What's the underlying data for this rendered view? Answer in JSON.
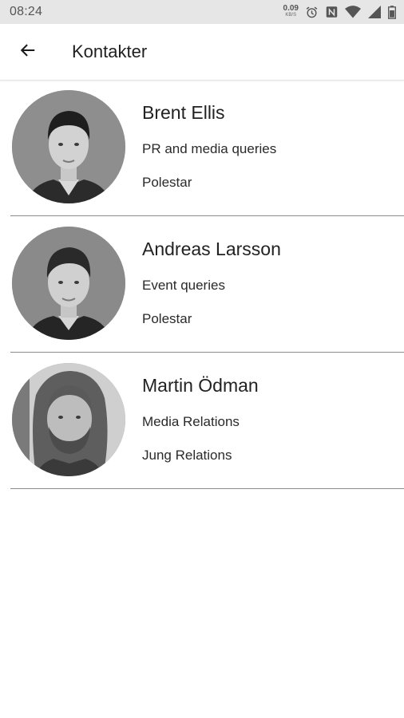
{
  "status_bar": {
    "time": "08:24",
    "net_speed_value": "0.09",
    "net_speed_unit": "KB/S",
    "icons": [
      "alarm-icon",
      "nfc-icon",
      "wifi-icon",
      "signal-icon",
      "battery-icon"
    ]
  },
  "header": {
    "back_icon": "arrow-left-icon",
    "title": "Kontakter"
  },
  "contacts": [
    {
      "name": "Brent Ellis",
      "role": "PR and media queries",
      "company": "Polestar"
    },
    {
      "name": "Andreas Larsson",
      "role": "Event queries",
      "company": "Polestar"
    },
    {
      "name": "Martin Ödman",
      "role": "Media Relations",
      "company": "Jung Relations"
    }
  ],
  "colors": {
    "status_bar_bg": "#e6e6e6",
    "divider": "#8a8a8a",
    "text": "#212121"
  }
}
